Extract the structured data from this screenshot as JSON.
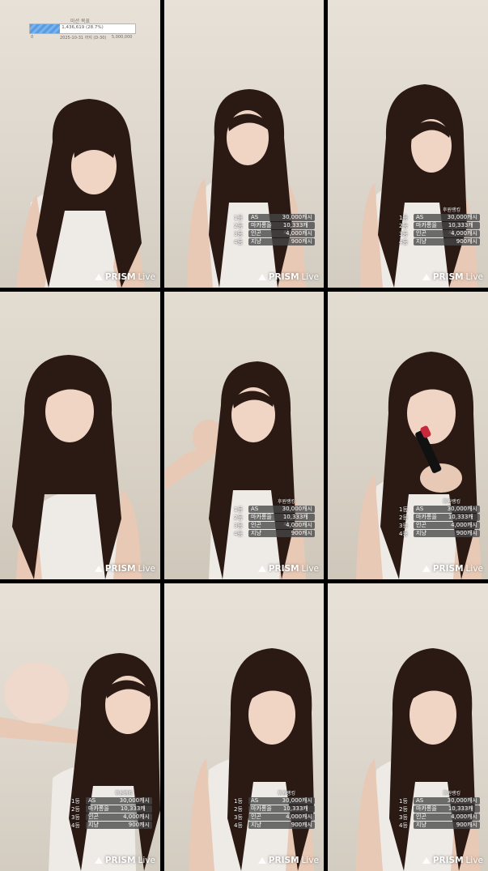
{
  "goal": {
    "title": "미션 목표",
    "progress_text": "1,436,619 (28.7%)",
    "progress": 0.287,
    "min": "0",
    "date": "2025-10-31 까지 (D-30)",
    "max": "5,000,000"
  },
  "ranking": {
    "title": "후원랭킹",
    "rows": [
      {
        "rank": "1등",
        "name": "AS",
        "amount": "30,000캐시"
      },
      {
        "rank": "2등",
        "name": "마카롱을 나...",
        "amount": "10,333캐시"
      },
      {
        "rank": "3등",
        "name": "인곤",
        "amount": "4,000캐시"
      },
      {
        "rank": "4등",
        "name": "지냥",
        "amount": "900캐시"
      }
    ]
  },
  "watermark": {
    "brand": "PRISM",
    "suffix": "Live"
  },
  "colors": {
    "hair": "#2b1a14",
    "skin": "#f0d4c4",
    "top": "#eeeae6",
    "lipstick": "#c8283c"
  }
}
